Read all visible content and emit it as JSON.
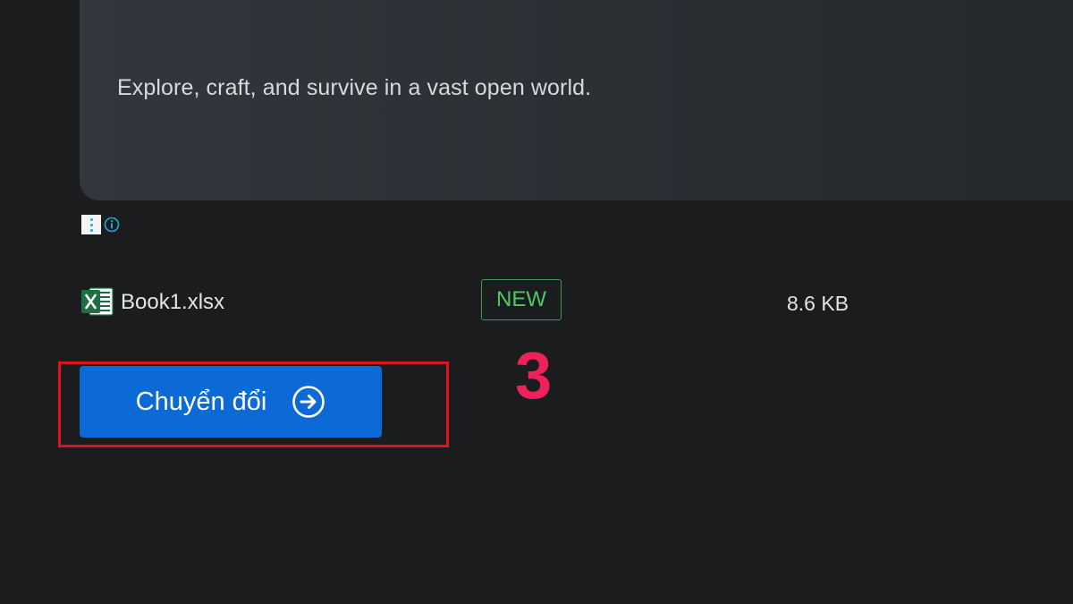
{
  "promo": {
    "description": "Explore, craft, and survive in a vast open world."
  },
  "ad_choices": {
    "icons": [
      "dots-menu-icon",
      "info-circle-icon"
    ],
    "dots_color": "#1ca8dd"
  },
  "file": {
    "icon": "excel-file-icon",
    "name": "Book1.xlsx",
    "status": "NEW",
    "size": "8.6 KB",
    "status_color": "#4fc864"
  },
  "convert_button": {
    "label": "Chuyển đổi",
    "icon": "arrow-right-circle-icon",
    "color": "#0b6ad6"
  },
  "annotation": {
    "step": "3",
    "highlight_color": "#e0141e",
    "step_color": "#f0215a"
  }
}
